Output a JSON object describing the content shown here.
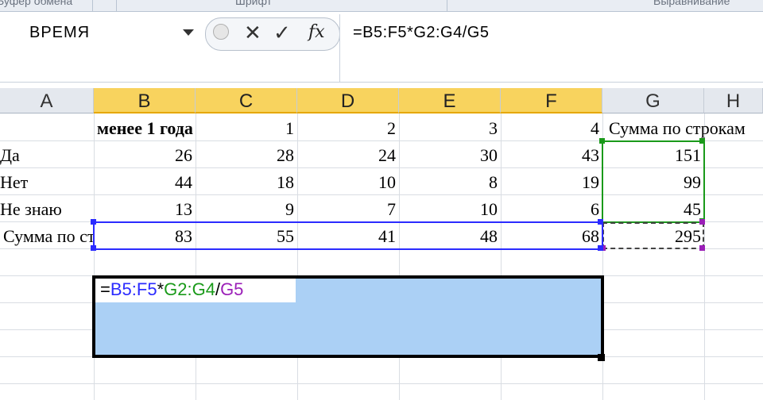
{
  "ribbon": {
    "groups": [
      "Буфер обмена",
      "Шрифт",
      "Выравнивание"
    ]
  },
  "formula_bar": {
    "name_box": "ВРЕМЯ",
    "cancel_glyph": "✕",
    "enter_glyph": "✓",
    "fx_label": "fx",
    "formula": "=B5:F5*G2:G4/G5"
  },
  "columns": [
    "A",
    "B",
    "C",
    "D",
    "E",
    "F",
    "G",
    "H"
  ],
  "rows": [
    {
      "a": "",
      "b": "менее 1 года",
      "c": "1",
      "d": "2",
      "e": "3",
      "f": "4",
      "g": "Сумма по строкам"
    },
    {
      "a": "Да",
      "b": "26",
      "c": "28",
      "d": "24",
      "e": "30",
      "f": "43",
      "g": "151"
    },
    {
      "a": "Нет",
      "b": "44",
      "c": "18",
      "d": "10",
      "e": "8",
      "f": "19",
      "g": "99"
    },
    {
      "a": "Не знаю",
      "b": "13",
      "c": "9",
      "d": "7",
      "e": "10",
      "f": "6",
      "g": "45"
    },
    {
      "a": "Сумма по столбцам",
      "b": "83",
      "c": "55",
      "d": "41",
      "e": "48",
      "f": "68",
      "g": "295"
    }
  ],
  "edit_cell": {
    "eq": "=",
    "ref1": "B5:F5",
    "op1": "*",
    "ref2": "G2:G4",
    "op2": "/",
    "ref3": "G5"
  },
  "colors": {
    "ref_blue": "#2b2bff",
    "ref_green": "#1a9a1a",
    "ref_purple": "#9b1fb8",
    "selected_header": "#f8d35e",
    "edit_fill": "#abd0f5"
  }
}
